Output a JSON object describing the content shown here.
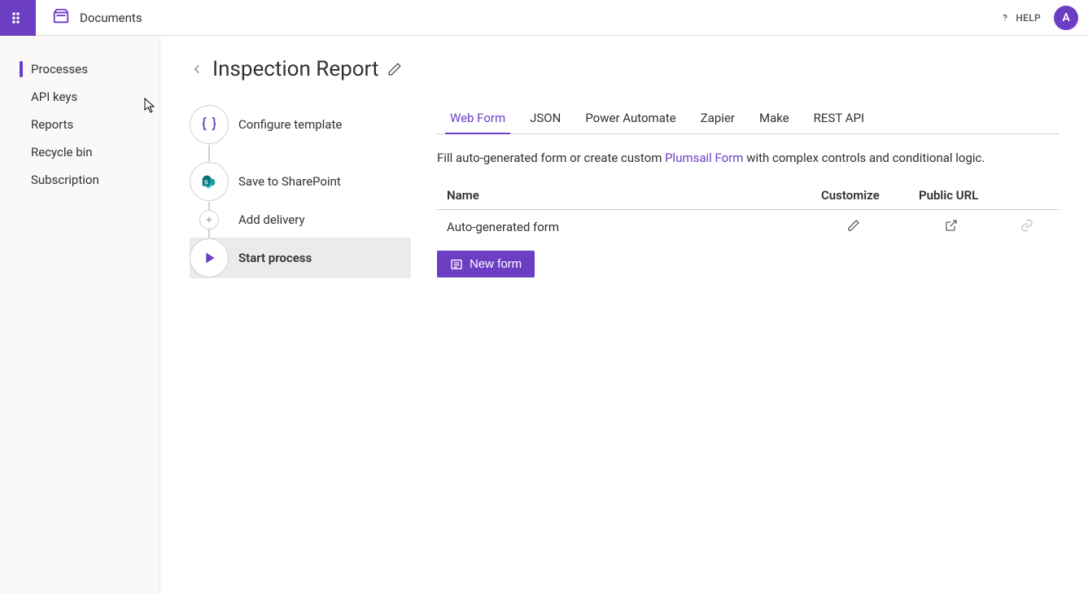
{
  "header": {
    "app_name": "Documents",
    "help_label": "HELP",
    "avatar_initial": "A"
  },
  "sidebar": {
    "items": [
      {
        "label": "Processes",
        "active": true
      },
      {
        "label": "API keys",
        "active": false
      },
      {
        "label": "Reports",
        "active": false
      },
      {
        "label": "Recycle bin",
        "active": false
      },
      {
        "label": "Subscription",
        "active": false
      }
    ]
  },
  "page": {
    "title": "Inspection Report",
    "steps": [
      {
        "label": "Configure template",
        "icon": "braces",
        "active": false
      },
      {
        "label": "Save to SharePoint",
        "icon": "sharepoint",
        "active": false
      },
      {
        "label": "Add delivery",
        "icon": "plus",
        "active": false,
        "small": true
      },
      {
        "label": "Start process",
        "icon": "play",
        "active": true
      }
    ]
  },
  "tabs": [
    {
      "label": "Web Form",
      "active": true
    },
    {
      "label": "JSON",
      "active": false
    },
    {
      "label": "Power Automate",
      "active": false
    },
    {
      "label": "Zapier",
      "active": false
    },
    {
      "label": "Make",
      "active": false
    },
    {
      "label": "REST API",
      "active": false
    }
  ],
  "hint": {
    "prefix": "Fill auto-generated form or create custom ",
    "link": "Plumsail Form",
    "suffix": " with complex controls and conditional logic."
  },
  "table": {
    "headers": {
      "name": "Name",
      "customize": "Customize",
      "url": "Public URL"
    },
    "rows": [
      {
        "name": "Auto-generated form"
      }
    ]
  },
  "new_form_label": "New form"
}
